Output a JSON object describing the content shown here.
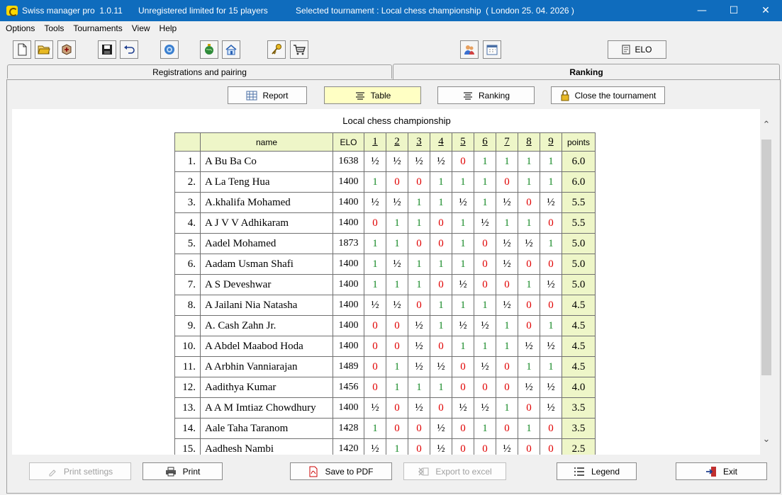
{
  "window": {
    "app_title": "Swiss manager pro  1.0.11",
    "license": "Unregistered limited for 15 players",
    "tournament": "Selected tournament : Local chess championship  ( London 25. 04. 2026 )",
    "minimize": "—",
    "maximize": "☐",
    "close": "✕"
  },
  "menu": [
    "Options",
    "Tools",
    "Tournaments",
    "View",
    "Help"
  ],
  "toolbar": {
    "elo_label": "ELO"
  },
  "tabs": {
    "registrations": "Registrations and pairing",
    "ranking": "Ranking"
  },
  "view_buttons": {
    "report": "Report",
    "table": "Table",
    "ranking": "Ranking",
    "close": "Close the tournament"
  },
  "report": {
    "title": "Local chess championship",
    "headers": {
      "name": "name",
      "elo": "ELO",
      "rounds": [
        "1",
        "2",
        "3",
        "4",
        "5",
        "6",
        "7",
        "8",
        "9"
      ],
      "points": "points"
    },
    "rows": [
      {
        "no": "1.",
        "name": "A Bu Ba Co",
        "elo": "1638",
        "r": [
          "½",
          "½",
          "½",
          "½",
          "0",
          "1",
          "1",
          "1",
          "1"
        ],
        "pts": "6.0"
      },
      {
        "no": "2.",
        "name": "A La Teng Hua",
        "elo": "1400",
        "r": [
          "1",
          "0",
          "0",
          "1",
          "1",
          "1",
          "0",
          "1",
          "1"
        ],
        "pts": "6.0"
      },
      {
        "no": "3.",
        "name": "A.khalifa Mohamed",
        "elo": "1400",
        "r": [
          "½",
          "½",
          "1",
          "1",
          "½",
          "1",
          "½",
          "0",
          "½"
        ],
        "pts": "5.5"
      },
      {
        "no": "4.",
        "name": "A J V V Adhikaram",
        "elo": "1400",
        "r": [
          "0",
          "1",
          "1",
          "0",
          "1",
          "½",
          "1",
          "1",
          "0"
        ],
        "pts": "5.5"
      },
      {
        "no": "5.",
        "name": "Aadel Mohamed",
        "elo": "1873",
        "r": [
          "1",
          "1",
          "0",
          "0",
          "1",
          "0",
          "½",
          "½",
          "1"
        ],
        "pts": "5.0"
      },
      {
        "no": "6.",
        "name": "Aadam Usman Shafi",
        "elo": "1400",
        "r": [
          "1",
          "½",
          "1",
          "1",
          "1",
          "0",
          "½",
          "0",
          "0"
        ],
        "pts": "5.0"
      },
      {
        "no": "7.",
        "name": "A S Deveshwar",
        "elo": "1400",
        "r": [
          "1",
          "1",
          "1",
          "0",
          "½",
          "0",
          "0",
          "1",
          "½"
        ],
        "pts": "5.0"
      },
      {
        "no": "8.",
        "name": "A Jailani Nia Natasha",
        "elo": "1400",
        "r": [
          "½",
          "½",
          "0",
          "1",
          "1",
          "1",
          "½",
          "0",
          "0"
        ],
        "pts": "4.5"
      },
      {
        "no": "9.",
        "name": "A. Cash Zahn Jr.",
        "elo": "1400",
        "r": [
          "0",
          "0",
          "½",
          "1",
          "½",
          "½",
          "1",
          "0",
          "1"
        ],
        "pts": "4.5"
      },
      {
        "no": "10.",
        "name": "A Abdel Maabod Hoda",
        "elo": "1400",
        "r": [
          "0",
          "0",
          "½",
          "0",
          "1",
          "1",
          "1",
          "½",
          "½"
        ],
        "pts": "4.5"
      },
      {
        "no": "11.",
        "name": "A Arbhin Vanniarajan",
        "elo": "1489",
        "r": [
          "0",
          "1",
          "½",
          "½",
          "0",
          "½",
          "0",
          "1",
          "1"
        ],
        "pts": "4.5"
      },
      {
        "no": "12.",
        "name": "Aadithya Kumar",
        "elo": "1456",
        "r": [
          "0",
          "1",
          "1",
          "1",
          "0",
          "0",
          "0",
          "½",
          "½"
        ],
        "pts": "4.0"
      },
      {
        "no": "13.",
        "name": "A A M Imtiaz Chowdhury",
        "elo": "1400",
        "r": [
          "½",
          "0",
          "½",
          "0",
          "½",
          "½",
          "1",
          "0",
          "½"
        ],
        "pts": "3.5"
      },
      {
        "no": "14.",
        "name": "Aale Taha Taranom",
        "elo": "1428",
        "r": [
          "1",
          "0",
          "0",
          "½",
          "0",
          "1",
          "0",
          "1",
          "0"
        ],
        "pts": "3.5"
      },
      {
        "no": "15.",
        "name": "Aadhesh Nambi",
        "elo": "1420",
        "r": [
          "½",
          "1",
          "0",
          "½",
          "0",
          "0",
          "½",
          "0",
          "0"
        ],
        "pts": "2.5"
      }
    ]
  },
  "bottom_buttons": {
    "print_settings": "Print settings",
    "print": "Print",
    "save_pdf": "Save to PDF",
    "export_excel": "Export to excel",
    "legend": "Legend",
    "exit": "Exit"
  },
  "colors": {
    "titlebar": "#0f6cbd",
    "win": "#1a8c2a",
    "loss": "#e00000",
    "highlight": "#eef6c8",
    "selected_button": "#ffffc4"
  }
}
